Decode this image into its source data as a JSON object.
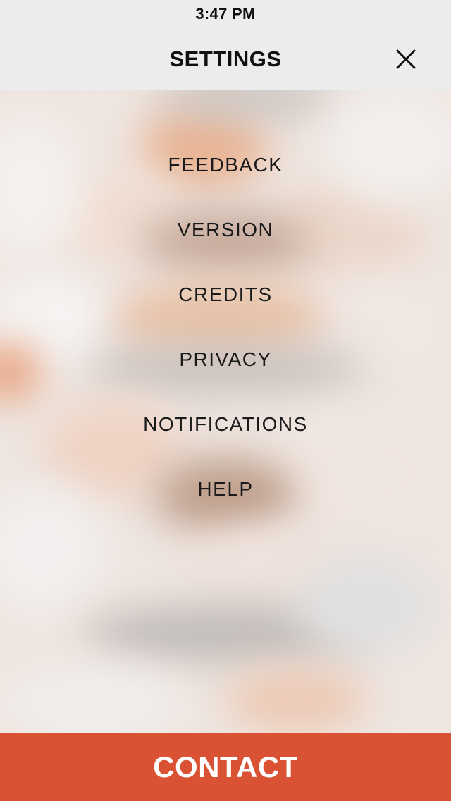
{
  "status_bar": {
    "time": "3:47 PM"
  },
  "header": {
    "title": "SETTINGS",
    "close_icon": "close-icon"
  },
  "menu": {
    "items": [
      {
        "label": "FEEDBACK"
      },
      {
        "label": "VERSION"
      },
      {
        "label": "CREDITS"
      },
      {
        "label": "PRIVACY"
      },
      {
        "label": "NOTIFICATIONS"
      },
      {
        "label": "HELP"
      }
    ]
  },
  "footer": {
    "contact_label": "CONTACT"
  },
  "colors": {
    "accent": "#d95233",
    "bar_background": "#ececec",
    "text": "#1a1a1a"
  }
}
